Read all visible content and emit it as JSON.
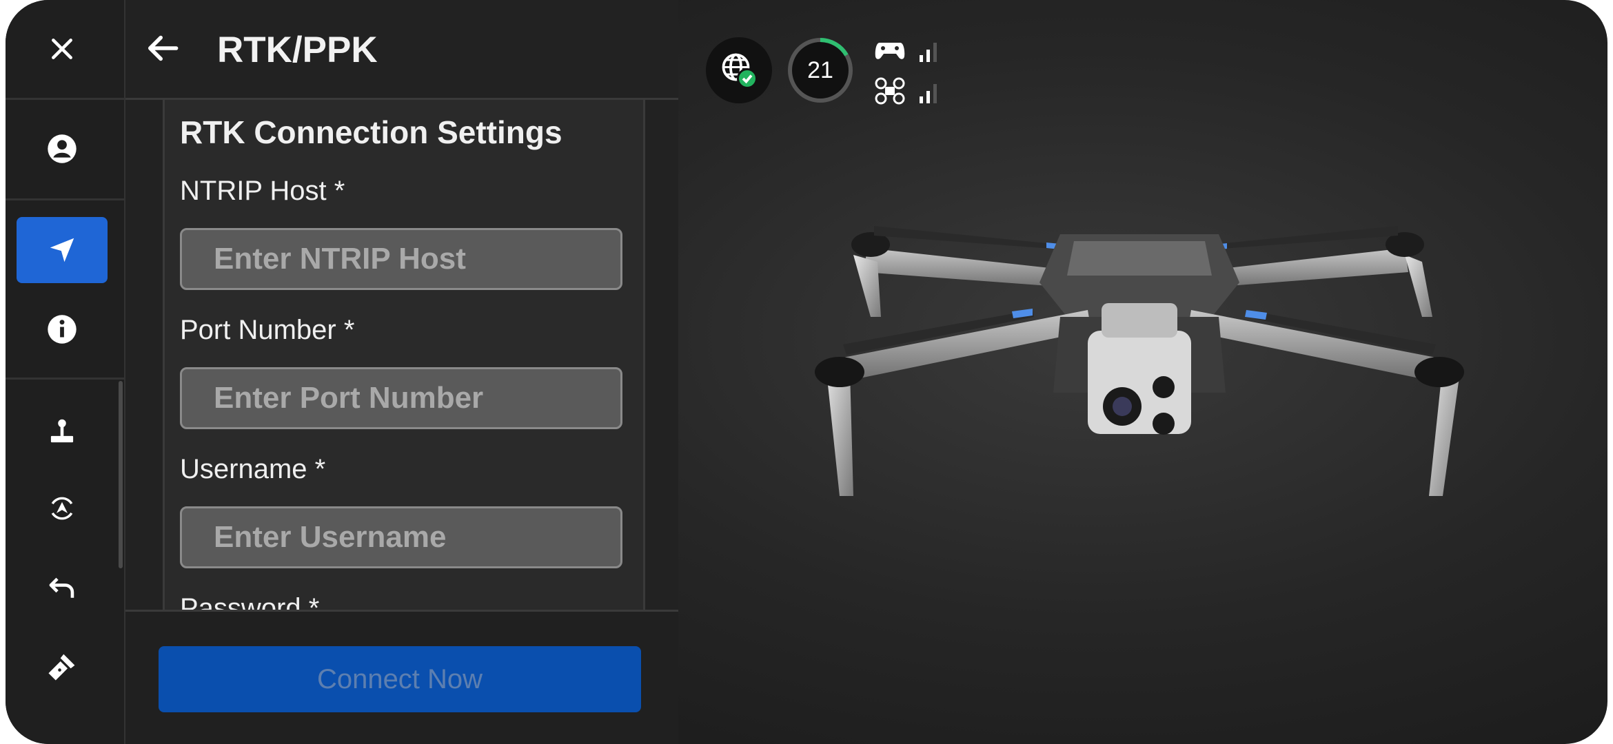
{
  "header": {
    "title": "RTK/PPK"
  },
  "form": {
    "section_title": "RTK Connection Settings",
    "fields": [
      {
        "label": "NTRIP Host *",
        "placeholder": "Enter NTRIP Host",
        "value": ""
      },
      {
        "label": "Port Number *",
        "placeholder": "Enter Port Number",
        "value": ""
      },
      {
        "label": "Username *",
        "placeholder": "Enter Username",
        "value": ""
      },
      {
        "label": "Password *",
        "placeholder": "",
        "value": ""
      }
    ]
  },
  "footer": {
    "connect_label": "Connect Now"
  },
  "status": {
    "satellite_count": "21",
    "satellite_ring_color": "#2fbf71",
    "rtk_ok_color": "#22b35e"
  },
  "sidebar": {
    "items": [
      {
        "icon": "close-icon"
      },
      {
        "icon": "account-icon"
      },
      {
        "icon": "navigation-icon",
        "active": true
      },
      {
        "icon": "info-icon"
      },
      {
        "icon": "joystick-icon"
      },
      {
        "icon": "calibration-icon"
      },
      {
        "icon": "return-icon"
      },
      {
        "icon": "flashlight-icon"
      }
    ]
  },
  "colors": {
    "accent": "#1f66d6",
    "connect_button": "#0a4fae",
    "panel": "#222222"
  }
}
